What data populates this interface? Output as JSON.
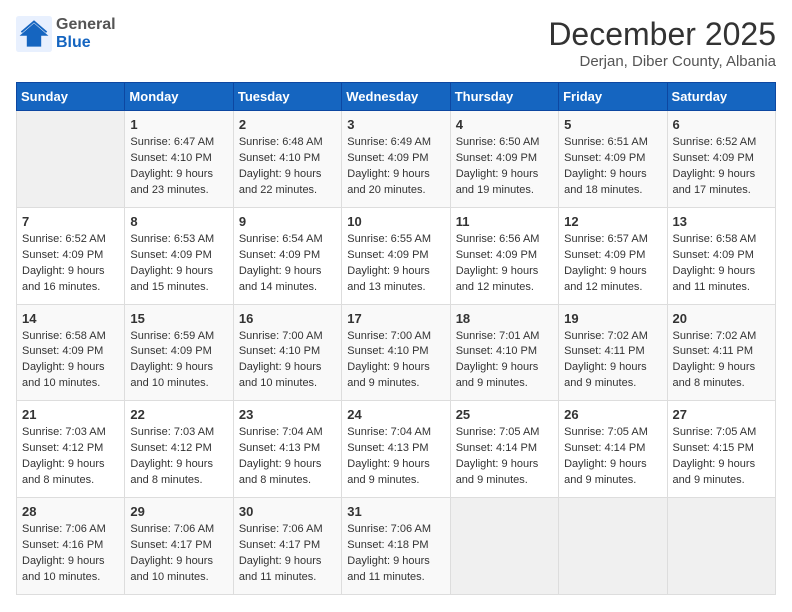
{
  "logo": {
    "general": "General",
    "blue": "Blue"
  },
  "header": {
    "month": "December 2025",
    "location": "Derjan, Diber County, Albania"
  },
  "weekdays": [
    "Sunday",
    "Monday",
    "Tuesday",
    "Wednesday",
    "Thursday",
    "Friday",
    "Saturday"
  ],
  "weeks": [
    [
      {
        "day": "",
        "sunrise": "",
        "sunset": "",
        "daylight": ""
      },
      {
        "day": "1",
        "sunrise": "Sunrise: 6:47 AM",
        "sunset": "Sunset: 4:10 PM",
        "daylight": "Daylight: 9 hours and 23 minutes."
      },
      {
        "day": "2",
        "sunrise": "Sunrise: 6:48 AM",
        "sunset": "Sunset: 4:10 PM",
        "daylight": "Daylight: 9 hours and 22 minutes."
      },
      {
        "day": "3",
        "sunrise": "Sunrise: 6:49 AM",
        "sunset": "Sunset: 4:09 PM",
        "daylight": "Daylight: 9 hours and 20 minutes."
      },
      {
        "day": "4",
        "sunrise": "Sunrise: 6:50 AM",
        "sunset": "Sunset: 4:09 PM",
        "daylight": "Daylight: 9 hours and 19 minutes."
      },
      {
        "day": "5",
        "sunrise": "Sunrise: 6:51 AM",
        "sunset": "Sunset: 4:09 PM",
        "daylight": "Daylight: 9 hours and 18 minutes."
      },
      {
        "day": "6",
        "sunrise": "Sunrise: 6:52 AM",
        "sunset": "Sunset: 4:09 PM",
        "daylight": "Daylight: 9 hours and 17 minutes."
      }
    ],
    [
      {
        "day": "7",
        "sunrise": "Sunrise: 6:52 AM",
        "sunset": "Sunset: 4:09 PM",
        "daylight": "Daylight: 9 hours and 16 minutes."
      },
      {
        "day": "8",
        "sunrise": "Sunrise: 6:53 AM",
        "sunset": "Sunset: 4:09 PM",
        "daylight": "Daylight: 9 hours and 15 minutes."
      },
      {
        "day": "9",
        "sunrise": "Sunrise: 6:54 AM",
        "sunset": "Sunset: 4:09 PM",
        "daylight": "Daylight: 9 hours and 14 minutes."
      },
      {
        "day": "10",
        "sunrise": "Sunrise: 6:55 AM",
        "sunset": "Sunset: 4:09 PM",
        "daylight": "Daylight: 9 hours and 13 minutes."
      },
      {
        "day": "11",
        "sunrise": "Sunrise: 6:56 AM",
        "sunset": "Sunset: 4:09 PM",
        "daylight": "Daylight: 9 hours and 12 minutes."
      },
      {
        "day": "12",
        "sunrise": "Sunrise: 6:57 AM",
        "sunset": "Sunset: 4:09 PM",
        "daylight": "Daylight: 9 hours and 12 minutes."
      },
      {
        "day": "13",
        "sunrise": "Sunrise: 6:58 AM",
        "sunset": "Sunset: 4:09 PM",
        "daylight": "Daylight: 9 hours and 11 minutes."
      }
    ],
    [
      {
        "day": "14",
        "sunrise": "Sunrise: 6:58 AM",
        "sunset": "Sunset: 4:09 PM",
        "daylight": "Daylight: 9 hours and 10 minutes."
      },
      {
        "day": "15",
        "sunrise": "Sunrise: 6:59 AM",
        "sunset": "Sunset: 4:09 PM",
        "daylight": "Daylight: 9 hours and 10 minutes."
      },
      {
        "day": "16",
        "sunrise": "Sunrise: 7:00 AM",
        "sunset": "Sunset: 4:10 PM",
        "daylight": "Daylight: 9 hours and 10 minutes."
      },
      {
        "day": "17",
        "sunrise": "Sunrise: 7:00 AM",
        "sunset": "Sunset: 4:10 PM",
        "daylight": "Daylight: 9 hours and 9 minutes."
      },
      {
        "day": "18",
        "sunrise": "Sunrise: 7:01 AM",
        "sunset": "Sunset: 4:10 PM",
        "daylight": "Daylight: 9 hours and 9 minutes."
      },
      {
        "day": "19",
        "sunrise": "Sunrise: 7:02 AM",
        "sunset": "Sunset: 4:11 PM",
        "daylight": "Daylight: 9 hours and 9 minutes."
      },
      {
        "day": "20",
        "sunrise": "Sunrise: 7:02 AM",
        "sunset": "Sunset: 4:11 PM",
        "daylight": "Daylight: 9 hours and 8 minutes."
      }
    ],
    [
      {
        "day": "21",
        "sunrise": "Sunrise: 7:03 AM",
        "sunset": "Sunset: 4:12 PM",
        "daylight": "Daylight: 9 hours and 8 minutes."
      },
      {
        "day": "22",
        "sunrise": "Sunrise: 7:03 AM",
        "sunset": "Sunset: 4:12 PM",
        "daylight": "Daylight: 9 hours and 8 minutes."
      },
      {
        "day": "23",
        "sunrise": "Sunrise: 7:04 AM",
        "sunset": "Sunset: 4:13 PM",
        "daylight": "Daylight: 9 hours and 8 minutes."
      },
      {
        "day": "24",
        "sunrise": "Sunrise: 7:04 AM",
        "sunset": "Sunset: 4:13 PM",
        "daylight": "Daylight: 9 hours and 9 minutes."
      },
      {
        "day": "25",
        "sunrise": "Sunrise: 7:05 AM",
        "sunset": "Sunset: 4:14 PM",
        "daylight": "Daylight: 9 hours and 9 minutes."
      },
      {
        "day": "26",
        "sunrise": "Sunrise: 7:05 AM",
        "sunset": "Sunset: 4:14 PM",
        "daylight": "Daylight: 9 hours and 9 minutes."
      },
      {
        "day": "27",
        "sunrise": "Sunrise: 7:05 AM",
        "sunset": "Sunset: 4:15 PM",
        "daylight": "Daylight: 9 hours and 9 minutes."
      }
    ],
    [
      {
        "day": "28",
        "sunrise": "Sunrise: 7:06 AM",
        "sunset": "Sunset: 4:16 PM",
        "daylight": "Daylight: 9 hours and 10 minutes."
      },
      {
        "day": "29",
        "sunrise": "Sunrise: 7:06 AM",
        "sunset": "Sunset: 4:17 PM",
        "daylight": "Daylight: 9 hours and 10 minutes."
      },
      {
        "day": "30",
        "sunrise": "Sunrise: 7:06 AM",
        "sunset": "Sunset: 4:17 PM",
        "daylight": "Daylight: 9 hours and 11 minutes."
      },
      {
        "day": "31",
        "sunrise": "Sunrise: 7:06 AM",
        "sunset": "Sunset: 4:18 PM",
        "daylight": "Daylight: 9 hours and 11 minutes."
      },
      {
        "day": "",
        "sunrise": "",
        "sunset": "",
        "daylight": ""
      },
      {
        "day": "",
        "sunrise": "",
        "sunset": "",
        "daylight": ""
      },
      {
        "day": "",
        "sunrise": "",
        "sunset": "",
        "daylight": ""
      }
    ]
  ]
}
